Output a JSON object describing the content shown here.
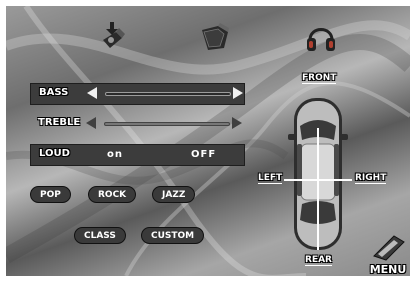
{
  "audio": {
    "bass": {
      "label": "BASS"
    },
    "treble": {
      "label": "TREBLE"
    },
    "loud": {
      "label": "LOUD",
      "on_label": "on",
      "off_label": "OFF"
    }
  },
  "presets": {
    "pop": "POP",
    "rock": "ROCK",
    "jazz": "JAZZ",
    "class": "CLASS",
    "custom": "CUSTOM"
  },
  "balance": {
    "front": "FRONT",
    "rear": "REAR",
    "left": "LEFT",
    "right": "RIGHT"
  },
  "menu": {
    "label": "MENU"
  },
  "icons": {
    "top_left": "speaker-icon",
    "top_center": "subwoofer-icon",
    "top_right": "headphones-icon",
    "menu": "menu-icon"
  }
}
